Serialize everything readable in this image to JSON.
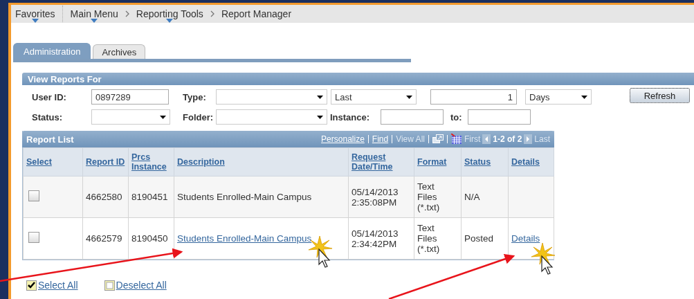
{
  "breadcrumbs": [
    {
      "kind": "first",
      "label": "Favorites",
      "menu": true
    },
    {
      "kind": "divided",
      "label": "Main Menu",
      "menu": true
    },
    {
      "kind": "chained",
      "label": "Reporting Tools",
      "menu": true
    },
    {
      "kind": "chained",
      "label": "Report Manager",
      "menu": false
    }
  ],
  "tabs": [
    {
      "label": "Administration",
      "selected": true
    },
    {
      "label": "Archives",
      "selected": false
    }
  ],
  "filters": {
    "title": "View Reports For",
    "rows": [
      [
        {
          "kind": "label",
          "text": "User ID:"
        },
        {
          "kind": "input",
          "value": "0897289"
        },
        {
          "kind": "label",
          "text": "Type:"
        },
        {
          "kind": "select"
        },
        {
          "kind": "select",
          "value": "Last"
        },
        {
          "kind": "number",
          "value": "1"
        },
        {
          "kind": "select",
          "value": "Days"
        },
        {
          "kind": "button",
          "text": "Refresh"
        }
      ],
      [
        {
          "kind": "label",
          "text": "Status:"
        },
        {
          "kind": "select"
        },
        {
          "kind": "label",
          "text": "Folder:"
        },
        {
          "kind": "select"
        },
        {
          "kind": "label",
          "text": "Instance:"
        },
        {
          "kind": "input"
        },
        {
          "kind": "label",
          "text": "to:"
        },
        {
          "kind": "input"
        }
      ]
    ]
  },
  "report_list": {
    "title": "Report List",
    "toolbar": {
      "personalize": "Personalize",
      "find": "Find",
      "view_all": {
        "label": "View All",
        "disabled": true
      },
      "first": {
        "label": "First",
        "disabled": true
      },
      "count": "1-2 of 2",
      "last": {
        "label": "Last",
        "disabled": true
      }
    },
    "columns": [
      "Select",
      "Report ID",
      "Prcs Instance",
      "Description",
      "Request Date/Time",
      "Format",
      "Status",
      "Details"
    ],
    "rows": [
      {
        "checked": false,
        "report_id": "4662580",
        "prcs_instance": "8190451",
        "description": "Students Enrolled-Main Campus",
        "description_link": false,
        "request_datetime": "05/14/2013 2:35:08PM",
        "format": "Text Files (*.txt)",
        "status": "N/A"
      },
      {
        "checked": false,
        "report_id": "4662579",
        "prcs_instance": "8190450",
        "description": "Students Enrolled-Main Campus",
        "description_link": true,
        "request_datetime": "05/14/2013 2:34:42PM",
        "format": "Text Files (*.txt)",
        "status": "Posted",
        "details": "Details"
      }
    ]
  },
  "actions": [
    {
      "kind": "check",
      "label": "Select All"
    },
    {
      "kind": "uncheck",
      "label": "Deselect All"
    }
  ]
}
